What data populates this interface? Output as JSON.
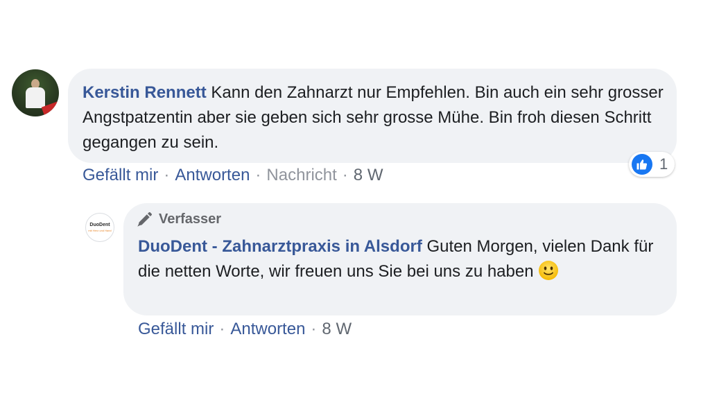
{
  "comment": {
    "author": "Kerstin Rennett",
    "text": "Kann den Zahnarzt nur Empfehlen. Bin auch ein sehr grosser Angstpatzentin aber sie geben sich sehr grosse Mühe. Bin froh diesen Schritt gegangen zu sein.",
    "actions": {
      "like": "Gefällt mir",
      "reply": "Antworten",
      "message": "Nachricht",
      "time": "8 W"
    },
    "reaction": {
      "icon": "thumbs-up-icon",
      "count": "1",
      "color": "#1877f2"
    }
  },
  "reply": {
    "badge": "Verfasser",
    "author": "DuoDent - Zahnarztpraxis in Alsdorf",
    "text": "Guten Morgen, vielen Dank für die netten Worte, wir freuen uns Sie bei uns zu haben",
    "emoji": "slightly-smiling-face-icon",
    "avatar_text": "DuoDent",
    "avatar_subtext": "mit Herz und Hand",
    "actions": {
      "like": "Gefällt mir",
      "reply": "Antworten",
      "time": "8 W"
    }
  },
  "colors": {
    "link": "#385898",
    "bubble": "#f0f2f5",
    "muted": "#90949c"
  }
}
